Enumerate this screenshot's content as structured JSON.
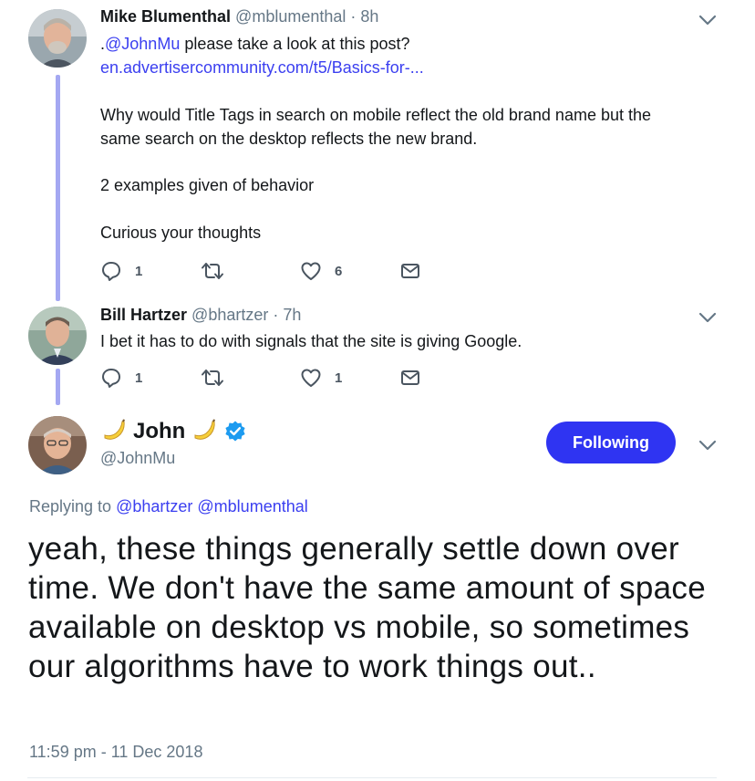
{
  "tweets": [
    {
      "name": "Mike Blumenthal",
      "handle": "@mblumenthal",
      "separator": "·",
      "time": "8h",
      "lines": [
        {
          "prefix": ".",
          "mention": "@JohnMu",
          "text": " please take a look at this post?"
        },
        {
          "link": "en.advertisercommunity.com/t5/Basics-for-..."
        }
      ],
      "paragraphs": [
        "Why would Title Tags in search on mobile reflect the old brand name but the",
        "same search on the desktop reflects the new brand.",
        "2 examples given of behavior",
        "Curious your thoughts"
      ],
      "replies": "1",
      "retweets": "",
      "likes": "6"
    },
    {
      "name": "Bill Hartzer",
      "handle": "@bhartzer",
      "separator": "·",
      "time": "7h",
      "text": "I bet it has to do with signals that the site is giving Google.",
      "replies": "1",
      "retweets": "",
      "likes": "1"
    }
  ],
  "main_tweet": {
    "name": "John",
    "name_emoji": "banana-icon",
    "verified": true,
    "handle": "@JohnMu",
    "follow_label": "Following",
    "replying_prefix": "Replying to",
    "replying_to": [
      "@bhartzer",
      "@mblumenthal"
    ],
    "text": "yeah, these things generally settle down over time. We don't have the same amount of space available on desktop vs mobile, so sometimes our algorithms have to work things out..",
    "timestamp": "11:59 pm - 11 Dec 2018"
  },
  "colors": {
    "accent": "#2f34f2",
    "link": "#3b3ff0",
    "thread_line": "#a4a8f2",
    "muted": "#657786"
  }
}
